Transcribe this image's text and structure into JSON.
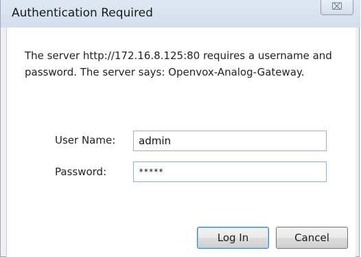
{
  "dialog": {
    "title": "Authentication Required",
    "close_glyph": "⌧",
    "close_icon": "close-icon",
    "message": "The server http://172.16.8.125:80 requires a username and password. The server says: Openvox-Analog-Gateway."
  },
  "form": {
    "username_label": "User Name:",
    "username_value": "admin",
    "password_label": "Password:",
    "password_value": "*****"
  },
  "buttons": {
    "login_label": "Log In",
    "cancel_label": "Cancel"
  },
  "colors": {
    "titlebar": "#d8e2ef",
    "focus_border": "#7eb4ea",
    "default_button_border": "#3c7fb1"
  }
}
